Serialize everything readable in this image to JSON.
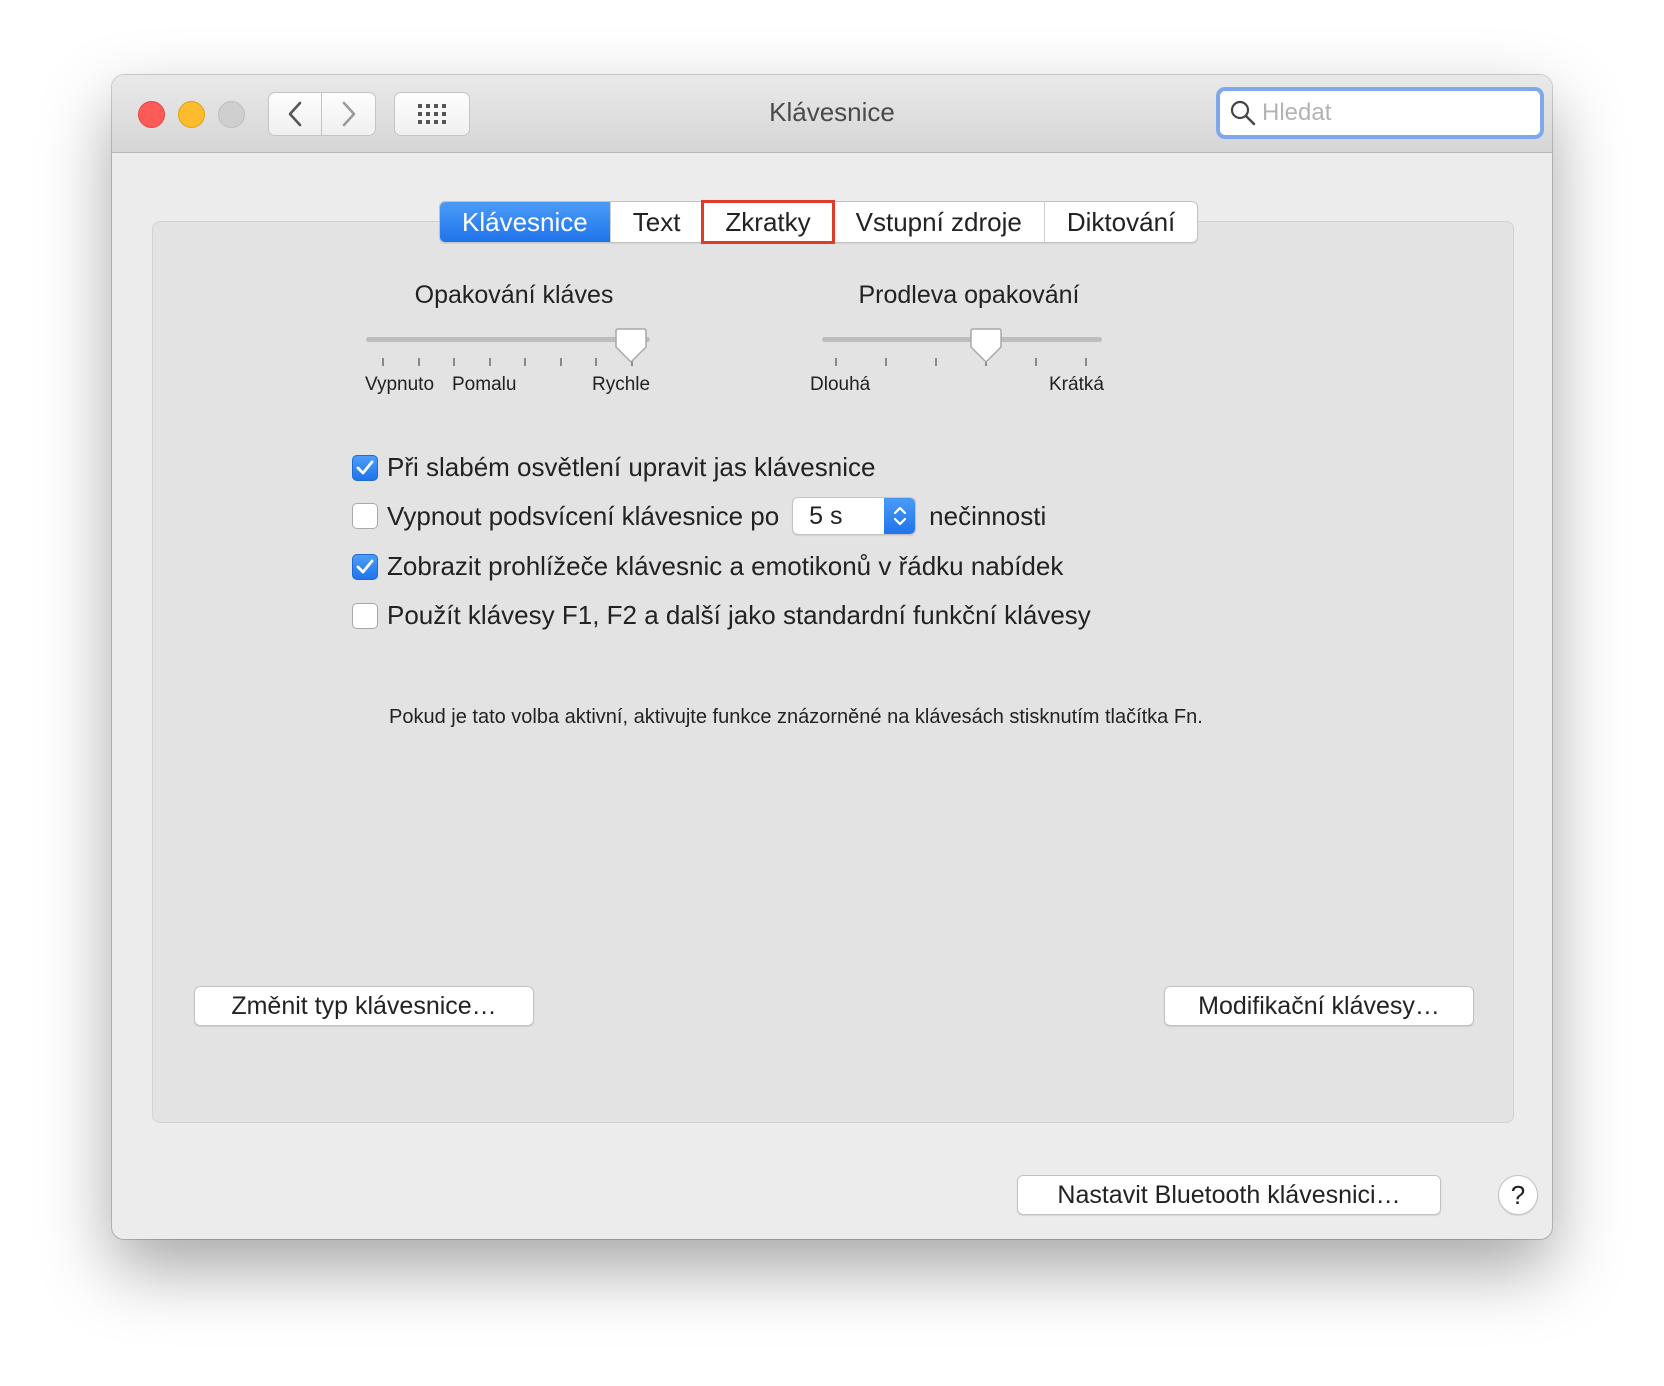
{
  "window": {
    "title": "Klávesnice",
    "search_placeholder": "Hledat"
  },
  "toolbar": {
    "back_icon": "chevron-left-icon",
    "forward_icon": "chevron-right-icon",
    "show_all_icon": "grid-icon"
  },
  "tabs": [
    {
      "label": "Klávesnice",
      "active": true
    },
    {
      "label": "Text",
      "active": false
    },
    {
      "label": "Zkratky",
      "active": false,
      "highlighted": true
    },
    {
      "label": "Vstupní zdroje",
      "active": false
    },
    {
      "label": "Diktování",
      "active": false
    }
  ],
  "key_repeat": {
    "title": "Opakování kláves",
    "labels": [
      "Vypnuto",
      "Pomalu",
      "Rychle"
    ],
    "tick_count": 8,
    "value_step": 7
  },
  "repeat_delay": {
    "title": "Prodleva opakování",
    "labels": [
      "Dlouhá",
      "Krátká"
    ],
    "tick_count": 6,
    "value_step": 3
  },
  "options": [
    {
      "label": "Při slabém osvětlení upravit jas klávesnice",
      "checked": true
    },
    {
      "label": "Vypnout podsvícení klávesnice po",
      "checked": false,
      "popup_value": "5 s",
      "after": "nečinnosti"
    },
    {
      "label": "Zobrazit prohlížeče klávesnic a emotikonů v řádku nabídek",
      "checked": true
    },
    {
      "label": "Použít klávesy F1, F2 a další jako standardní funkční klávesy",
      "checked": false
    }
  ],
  "fn_hint": "Pokud je tato volba aktivní, aktivujte funkce znázorněné na klávesách stisknutím tlačítka Fn.",
  "buttons": {
    "change_type": "Změnit typ klávesnice…",
    "modifier_keys": "Modifikační klávesy…",
    "bluetooth": "Nastavit Bluetooth klávesnici…",
    "help": "?"
  },
  "colors": {
    "accent": "#1f73ea",
    "highlight_outline": "#e03a2b"
  }
}
